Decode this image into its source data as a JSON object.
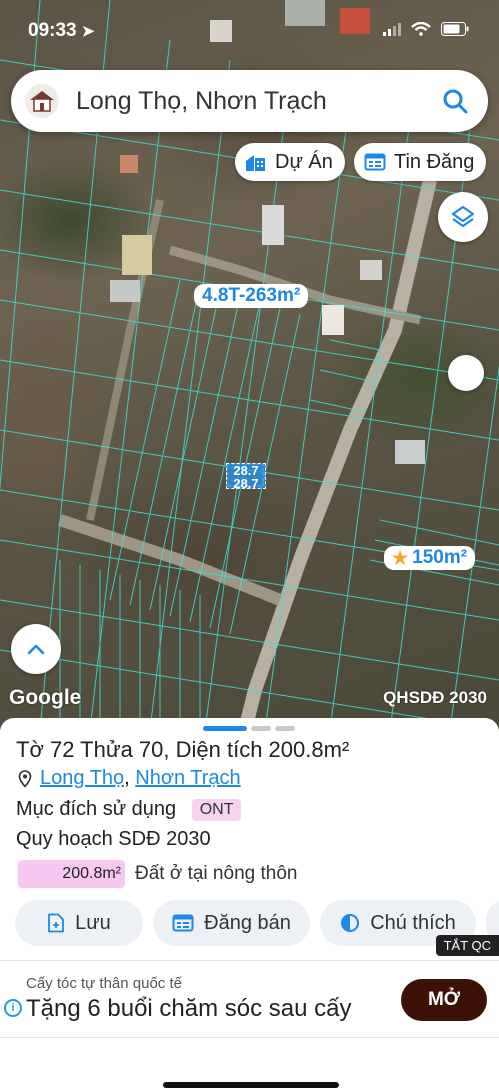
{
  "status_bar": {
    "time": "09:33"
  },
  "search": {
    "text": "Long Thọ, Nhơn Trạch"
  },
  "chips": {
    "projects": "Dự Án",
    "listings": "Tin Đăng"
  },
  "map": {
    "lot_area_label": "4.8T-263m²",
    "parcel_label_a": "28.7",
    "parcel_label_b": "28.7",
    "featured_area_label": "150m²",
    "google_logo": "Google",
    "layer_name": "QHSDĐ 2030"
  },
  "parcel": {
    "title": "Tờ 72 Thửa 70, Diện tích 200.8m²",
    "location_ward": "Long Thọ",
    "location_separator": ", ",
    "location_district": "Nhơn Trạch",
    "purpose_label": "Mục đích sử dụng",
    "purpose_code": "ONT",
    "planning_label": "Quy hoạch SDĐ 2030",
    "planning_area": "200.8m²",
    "planning_desc": "Đất ở tại nông thôn"
  },
  "actions": {
    "save": "Lưu",
    "post_sale": "Đăng bán",
    "legend": "Chú thích"
  },
  "ad": {
    "close_all": "TẮT QC",
    "sponsor": "Cấy tóc tự thân quốc tế",
    "headline": "Tặng 6 buổi chăm sóc sau cấy",
    "cta": "MỞ"
  },
  "colors": {
    "accent": "#1e88e5",
    "parcel_lines": "#3fe0d0",
    "ont_pink": "#f8c8f1",
    "ad_button": "#3c1207"
  },
  "pager": {
    "active_page": 1,
    "page_count": 3
  }
}
